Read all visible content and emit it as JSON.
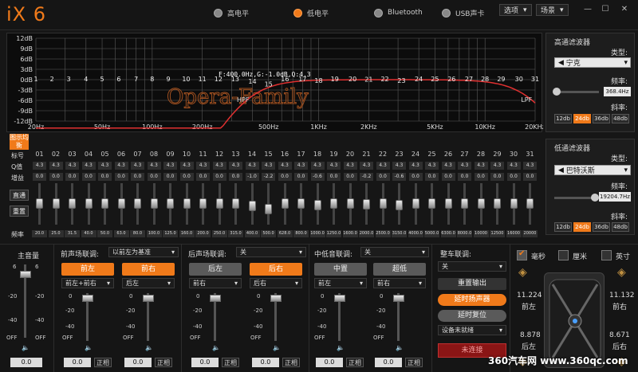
{
  "app": {
    "logo": "iX 6"
  },
  "modes": [
    {
      "label": "高电平",
      "active": false
    },
    {
      "label": "低电平",
      "active": true
    },
    {
      "label": "Bluetooth",
      "active": false
    },
    {
      "label": "USB声卡",
      "active": false
    }
  ],
  "menu": {
    "options": "选项",
    "scene": "场景"
  },
  "graph": {
    "db_labels": [
      "12dB",
      "9dB",
      "6dB",
      "3dB",
      "0dB",
      "-3dB",
      "-6dB",
      "-9dB",
      "-12dB"
    ],
    "freq_labels": [
      "20Hz",
      "50Hz",
      "100Hz",
      "200Hz",
      "500Hz",
      "1KHz",
      "2KHz",
      "5KHz",
      "10KHz",
      "20KHz"
    ],
    "readout": "F:400.0Hz,G:-1.0dB,Q:4.3",
    "hpf": "HPF",
    "lpf": "LPF",
    "watermark": "Opera-Family",
    "band_markers": [
      "1",
      "2",
      "3",
      "4",
      "5",
      "6",
      "7",
      "8",
      "9",
      "10",
      "11",
      "12",
      "13",
      "14",
      "15",
      "16",
      "17",
      "18",
      "19",
      "20",
      "21",
      "22",
      "23",
      "24",
      "25",
      "26",
      "27",
      "28",
      "29",
      "30",
      "31"
    ]
  },
  "hp_filter": {
    "title": "高通滤波器",
    "type_label": "类型:",
    "type_value": "宁克",
    "freq_label": "频率:",
    "freq_value": "368.4Hz",
    "slope_label": "斜率:",
    "slopes": [
      "12db",
      "24db",
      "36db",
      "48db"
    ],
    "active_slope": 1
  },
  "lp_filter": {
    "title": "低通滤波器",
    "type_label": "类型:",
    "type_value": "巴特沃斯",
    "freq_label": "频率:",
    "freq_value": "19204.7Hz",
    "slope_label": "斜率:",
    "slopes": [
      "12db",
      "24db",
      "36db",
      "48db"
    ],
    "active_slope": 1
  },
  "eq": {
    "bypass_button": "图示均衡",
    "row_band": "标号",
    "row_q": "Q值",
    "row_gain": "增益",
    "row_freq": "频率",
    "direct_button": "直通",
    "reset_button": "重置",
    "bands": [
      {
        "n": "01",
        "q": "4.3",
        "g": "0.0",
        "f": "20.0"
      },
      {
        "n": "02",
        "q": "4.3",
        "g": "0.0",
        "f": "25.0"
      },
      {
        "n": "03",
        "q": "4.3",
        "g": "0.0",
        "f": "31.5"
      },
      {
        "n": "04",
        "q": "4.3",
        "g": "0.0",
        "f": "40.0"
      },
      {
        "n": "05",
        "q": "4.3",
        "g": "0.0",
        "f": "50.0"
      },
      {
        "n": "06",
        "q": "4.3",
        "g": "0.0",
        "f": "63.0"
      },
      {
        "n": "07",
        "q": "4.3",
        "g": "0.0",
        "f": "80.0"
      },
      {
        "n": "08",
        "q": "4.3",
        "g": "0.0",
        "f": "100.0"
      },
      {
        "n": "09",
        "q": "4.3",
        "g": "0.0",
        "f": "125.0"
      },
      {
        "n": "10",
        "q": "4.3",
        "g": "0.0",
        "f": "160.0"
      },
      {
        "n": "11",
        "q": "4.3",
        "g": "0.0",
        "f": "200.0"
      },
      {
        "n": "12",
        "q": "4.3",
        "g": "0.0",
        "f": "250.0"
      },
      {
        "n": "13",
        "q": "4.3",
        "g": "0.0",
        "f": "315.0"
      },
      {
        "n": "14",
        "q": "4.3",
        "g": "-1.0",
        "f": "400.0"
      },
      {
        "n": "15",
        "q": "4.3",
        "g": "-2.2",
        "f": "500.0"
      },
      {
        "n": "16",
        "q": "4.3",
        "g": "0.0",
        "f": "628.0"
      },
      {
        "n": "17",
        "q": "4.3",
        "g": "0.0",
        "f": "800.0"
      },
      {
        "n": "18",
        "q": "4.3",
        "g": "-0.6",
        "f": "1000.0"
      },
      {
        "n": "19",
        "q": "4.3",
        "g": "0.0",
        "f": "1250.0"
      },
      {
        "n": "20",
        "q": "4.3",
        "g": "0.0",
        "f": "1600.0"
      },
      {
        "n": "21",
        "q": "4.3",
        "g": "-0.2",
        "f": "2000.0"
      },
      {
        "n": "22",
        "q": "4.3",
        "g": "0.0",
        "f": "2500.0"
      },
      {
        "n": "23",
        "q": "4.3",
        "g": "-0.6",
        "f": "3150.0"
      },
      {
        "n": "24",
        "q": "4.3",
        "g": "0.0",
        "f": "4000.0"
      },
      {
        "n": "25",
        "q": "4.3",
        "g": "0.0",
        "f": "5000.0"
      },
      {
        "n": "26",
        "q": "4.3",
        "g": "0.0",
        "f": "6300.0"
      },
      {
        "n": "27",
        "q": "4.3",
        "g": "0.0",
        "f": "8000.0"
      },
      {
        "n": "28",
        "q": "4.3",
        "g": "0.0",
        "f": "10000"
      },
      {
        "n": "29",
        "q": "4.3",
        "g": "0.0",
        "f": "12500"
      },
      {
        "n": "30",
        "q": "4.3",
        "g": "0.0",
        "f": "16000"
      },
      {
        "n": "31",
        "q": "4.3",
        "g": "0.0",
        "f": "20000"
      }
    ]
  },
  "master": {
    "title": "主音量",
    "scale_top": "6",
    "scale_mid": [
      "-20",
      "-40"
    ],
    "scale_bottom": "OFF",
    "value": "0.0"
  },
  "front": {
    "title": "前声场联调:",
    "dropdown": "以前左为基准",
    "left": "前左",
    "right": "前右",
    "left_sel": "前左+前右",
    "right_sel": "后左",
    "left_val": "0.0",
    "right_val": "0.0",
    "phase": "正相"
  },
  "rear": {
    "title": "后声场联调:",
    "dropdown": "关",
    "left": "后左",
    "right": "后右",
    "left_sel": "前右",
    "right_sel": "后右",
    "left_val": "0.0",
    "right_val": "0.0",
    "phase": "正相"
  },
  "mid": {
    "title": "中低音联调:",
    "dropdown": "关",
    "left": "中置",
    "right": "超低",
    "left_sel": "前左",
    "right_sel": "前右",
    "left_val": "0.0",
    "right_val": "0.0",
    "phase": "正相"
  },
  "slider_scale": {
    "top": "0",
    "mid": [
      "-20",
      "-40"
    ],
    "bottom": "OFF"
  },
  "car": {
    "title": "整车联调:",
    "dropdown": "关",
    "reset_out": "重置输出",
    "delay_speaker": "延时扬声器",
    "delay_reset": "延时复位",
    "device": "设备未就绪",
    "connect": "未连接"
  },
  "units": [
    {
      "label": "毫秒",
      "checked": true
    },
    {
      "label": "厘米",
      "checked": false
    },
    {
      "label": "英寸",
      "checked": false
    }
  ],
  "positions": {
    "fl_val": "11.224",
    "fl": "前左",
    "fr_val": "11.132",
    "fr": "前右",
    "rl_val": "8.878",
    "rl": "后左",
    "rr_val": "8.671",
    "rr": "后右"
  },
  "watermark": "360汽车网 www.360qc.com"
}
